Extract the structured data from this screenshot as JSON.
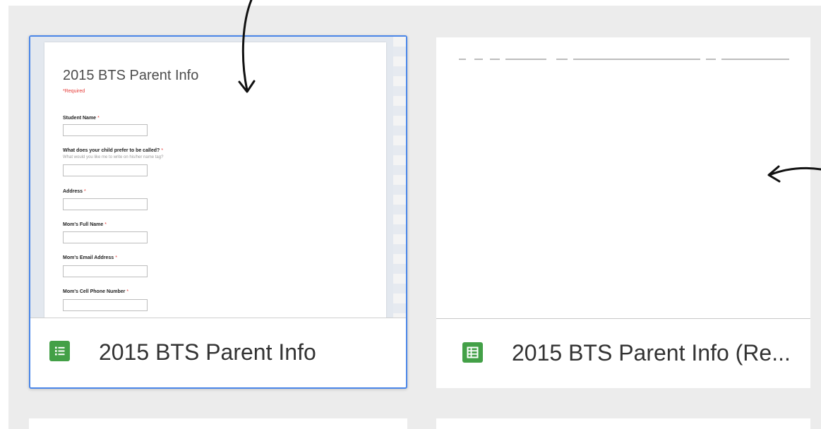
{
  "cards": [
    {
      "name": "2015 BTS Parent Info",
      "type_icon": "google-forms-icon",
      "selected": true,
      "preview": {
        "title": "2015 BTS Parent Info",
        "required_note": "*Required",
        "questions": [
          {
            "label": "Student Name",
            "help": ""
          },
          {
            "label": "What does your child prefer to be called?",
            "help": "What would you like me to write on his/her name tag?"
          },
          {
            "label": "Address",
            "help": ""
          },
          {
            "label": "Mom's Full Name",
            "help": ""
          },
          {
            "label": "Mom's Email Address",
            "help": ""
          },
          {
            "label": "Mom's Cell Phone Number",
            "help": ""
          }
        ]
      }
    },
    {
      "name": "2015 BTS Parent Info (Re...",
      "type_icon": "google-sheets-icon",
      "selected": false
    }
  ],
  "colors": {
    "selection_border": "#4a86e8",
    "app_icon_green": "#43a047",
    "required_red": "#e53935",
    "background": "#ececec"
  }
}
